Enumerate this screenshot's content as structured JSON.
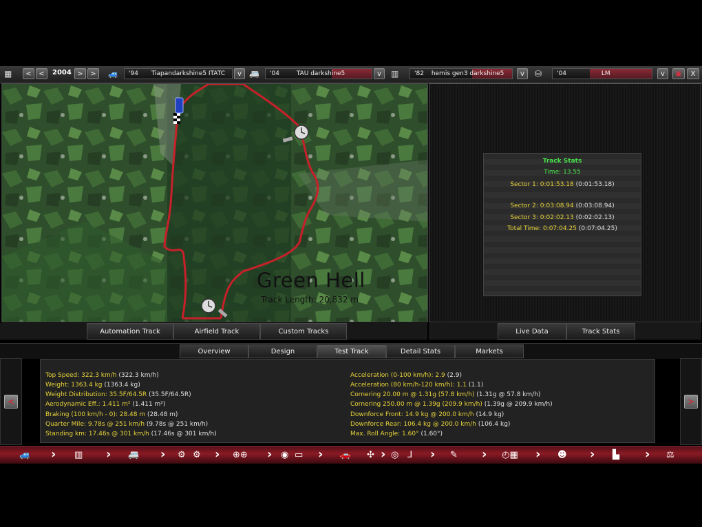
{
  "toolbar": {
    "year": "2004",
    "prev_fast": "<",
    "prev": "<",
    "next": ">",
    "next_fast": ">",
    "slot1": {
      "year": "'94",
      "name": "Tiapandarkshine5 ITATC",
      "dropdown": "v"
    },
    "slot2": {
      "year": "'04",
      "name": "TAU darkshine5",
      "dropdown": "v"
    },
    "slot3": {
      "year": "'82",
      "name": "hemis gen3 darkshine5",
      "dropdown": "v"
    },
    "slot4": {
      "year": "'04",
      "name": "LM",
      "dropdown": "v"
    },
    "close": "X"
  },
  "map": {
    "title": "Green Hell",
    "length": "Track Length: 20,832 m"
  },
  "track_tabs": [
    "Automation Track",
    "Airfield Track",
    "Custom Tracks"
  ],
  "right_tabs": [
    "Live Data",
    "Track Stats"
  ],
  "track_stats": {
    "title": "Track Stats",
    "time": "Time: 13.55",
    "sector1": {
      "label": "Sector 1: 0:01:53.18",
      "value": "(0:01:53.18)"
    },
    "sector2": {
      "label": "Sector 2: 0:03:08.94",
      "value": "(0:03:08.94)"
    },
    "sector3": {
      "label": "Sector 3: 0:02:02.13",
      "value": "(0:02:02.13)"
    },
    "total": {
      "label": "Total Time: 0:07:04.25",
      "value": "(0:07:04.25)"
    }
  },
  "main_tabs": [
    "Overview",
    "Design",
    "Test Track",
    "Detail Stats",
    "Markets"
  ],
  "nav_prev": "<",
  "nav_next": ">",
  "stats_left": [
    {
      "k": "Top Speed: 322.3 km/h",
      "v": "(322.3 km/h)"
    },
    {
      "k": "Weight: 1363.4 kg",
      "v": "(1363.4 kg)"
    },
    {
      "k": "Weight Distribution: 35.5F/64.5R",
      "v": "(35.5F/64.5R)"
    },
    {
      "k": "Aerodynamic Eff.: 1.411 m²",
      "v": "(1.411 m²)"
    },
    {
      "k": "Braking (100 km/h - 0): 28.48 m",
      "v": "(28.48 m)"
    },
    {
      "k": "Quarter Mile: 9.78s @ 251 km/h",
      "v": "(9.78s @ 251 km/h)"
    },
    {
      "k": "Standing km: 17.46s @ 301 km/h",
      "v": "(17.46s @ 301 km/h)"
    }
  ],
  "stats_right": [
    {
      "k": "Acceleration (0-100 km/h): 2.9",
      "v": "(2.9)"
    },
    {
      "k": "Acceleration (80 km/h-120 km/h): 1.1",
      "v": "(1.1)"
    },
    {
      "k": "Cornering 20.00 m @ 1.31g (57.8 km/h)",
      "v": "(1.31g @ 57.8 km/h)"
    },
    {
      "k": "Cornering 250.00 m @ 1.39g (209.9 km/h)",
      "v": "(1.39g @ 209.9 km/h)"
    },
    {
      "k": "Downforce Front: 14.9 kg @ 200.0 km/h",
      "v": "(14.9 kg)"
    },
    {
      "k": "Downforce Rear: 106.4 kg @ 200.0 km/h",
      "v": "(106.4 kg)"
    },
    {
      "k": "Max. Roll Angle: 1.60°",
      "v": "(1.60°)"
    }
  ],
  "colors": {
    "accent_red": "#8a1a24",
    "stat_yellow": "#e8d33a",
    "stat_green": "#47e04a",
    "track_line": "#c8202a"
  }
}
